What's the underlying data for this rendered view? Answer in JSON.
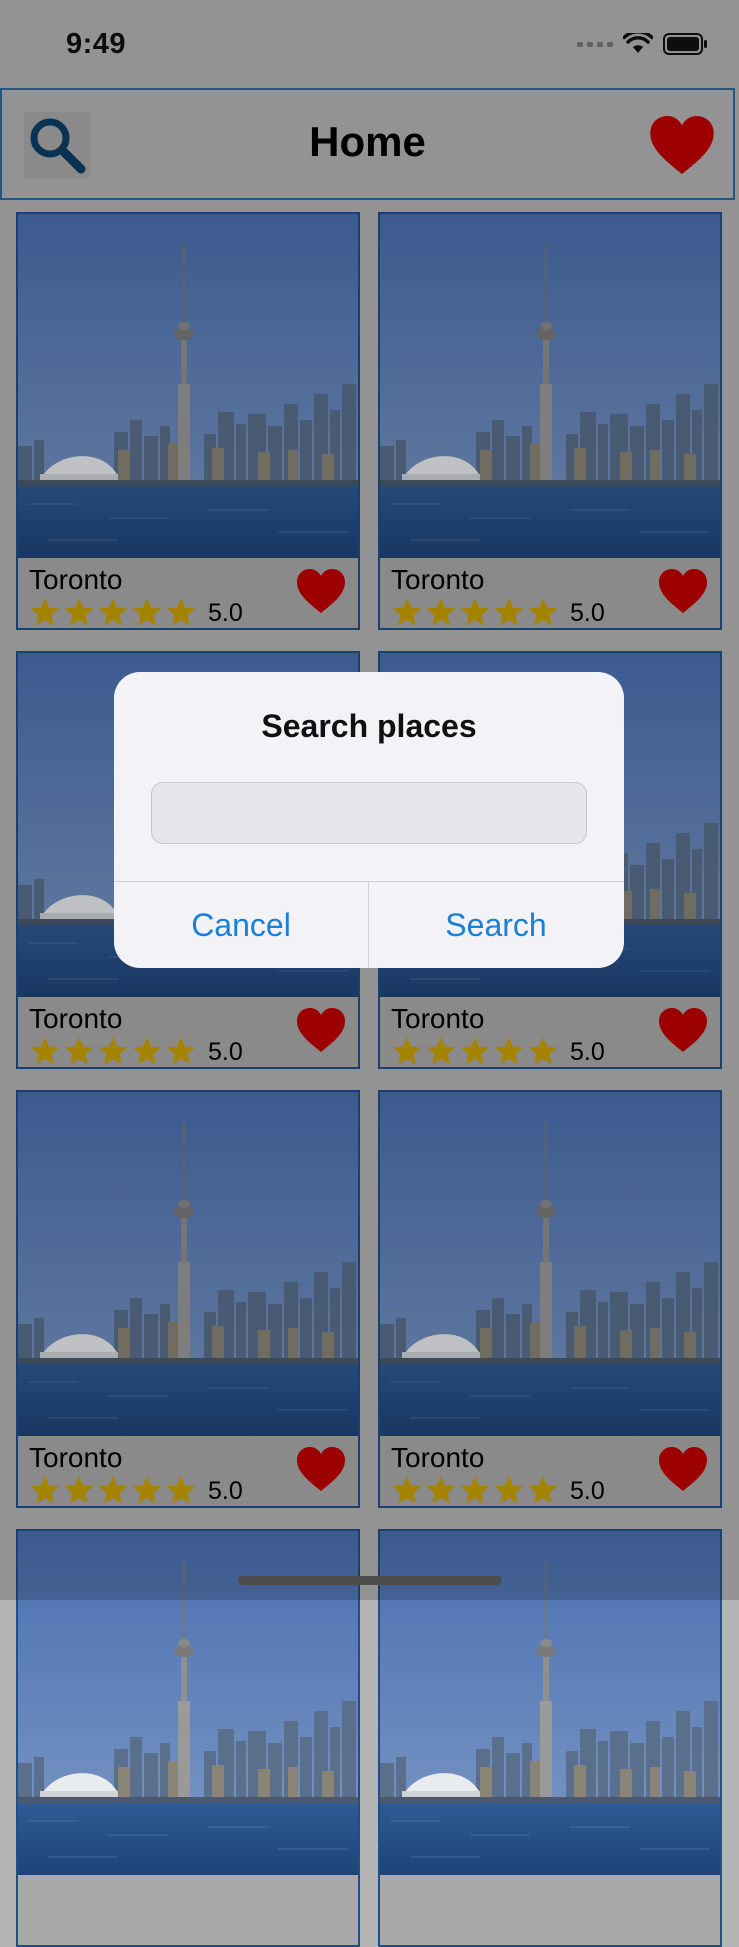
{
  "status_bar": {
    "time": "9:49"
  },
  "nav": {
    "title": "Home",
    "search_icon": "search-icon",
    "favorites_icon": "heart-icon"
  },
  "places": [
    {
      "name": "Toronto",
      "rating": "5.0",
      "stars": 5
    },
    {
      "name": "Toronto",
      "rating": "5.0",
      "stars": 5
    },
    {
      "name": "Toronto",
      "rating": "5.0",
      "stars": 5
    },
    {
      "name": "Toronto",
      "rating": "5.0",
      "stars": 5
    },
    {
      "name": "Toronto",
      "rating": "5.0",
      "stars": 5
    },
    {
      "name": "Toronto",
      "rating": "5.0",
      "stars": 5
    },
    {
      "name": "",
      "rating": "",
      "stars": 0
    },
    {
      "name": "",
      "rating": "",
      "stars": 0
    }
  ],
  "dialog": {
    "title": "Search places",
    "input_value": "",
    "input_placeholder": "",
    "cancel_label": "Cancel",
    "search_label": "Search"
  },
  "colors": {
    "accent": "#1a7fd6",
    "heart": "#c00000",
    "star": "#c9a000",
    "card_border": "#1f4f8a"
  }
}
